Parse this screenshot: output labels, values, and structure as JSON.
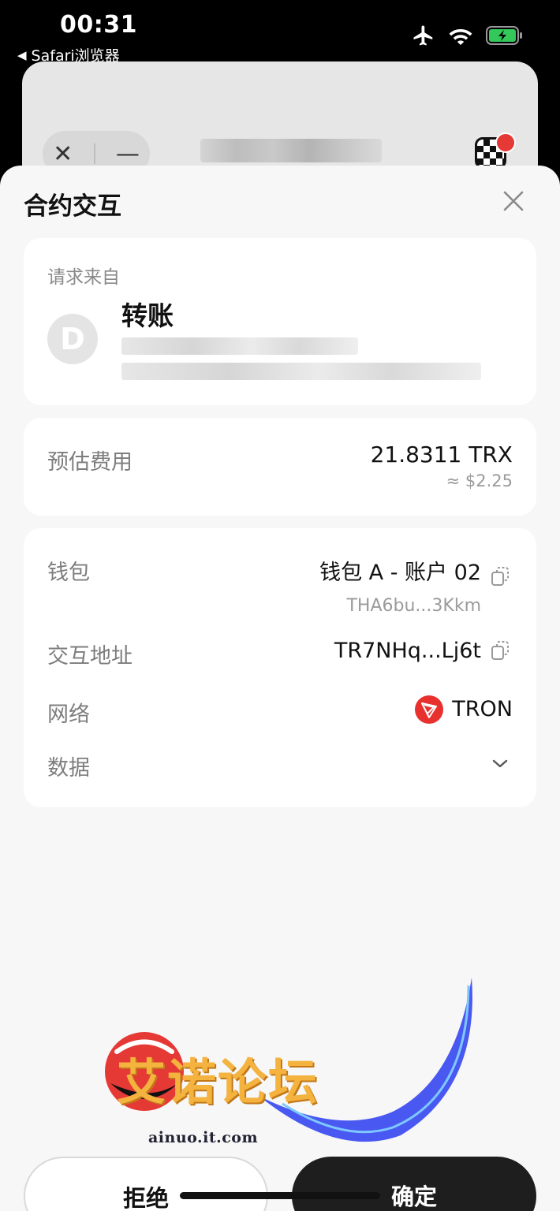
{
  "status_bar": {
    "time": "00:31",
    "back_app": "Safari浏览器",
    "icons": [
      "airplane-icon",
      "wifi-icon",
      "battery-charging-icon"
    ],
    "battery_color": "#34c759"
  },
  "background_browser": {
    "close_glyph": "✕",
    "minimize_glyph": "—"
  },
  "sheet": {
    "title": "合约交互",
    "request": {
      "label": "请求来自",
      "avatar_letter": "D",
      "name": "转账"
    },
    "fee": {
      "label": "预估费用",
      "amount": "21.8311 TRX",
      "usd": "≈ $2.25"
    },
    "details": {
      "wallet_label": "钱包",
      "wallet_name": "钱包 A - 账户 02",
      "wallet_address": "THA6bu...3Kkm",
      "contract_label": "交互地址",
      "contract_address": "TR7NHq...Lj6t",
      "network_label": "网络",
      "network_name": "TRON",
      "data_label": "数据"
    },
    "actions": {
      "reject": "拒绝",
      "confirm": "确定"
    }
  },
  "watermark": {
    "text": "艾诺论坛",
    "domain": "ainuo.it.com"
  },
  "colors": {
    "tron_red": "#e8312f",
    "confirm_bg": "#1e1e1e",
    "sheet_bg": "#f7f7f7"
  }
}
